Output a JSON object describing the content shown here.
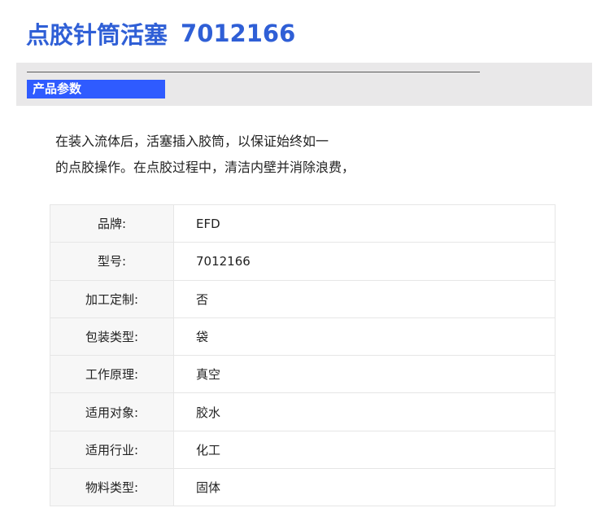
{
  "header": {
    "title": "点胶针筒活塞",
    "code": "7012166"
  },
  "section": {
    "label": "产品参数"
  },
  "description": {
    "line1": "在装入流体后，活塞插入胶筒，以保证始终如一",
    "line2": "的点胶操作。在点胶过程中，清洁内壁并消除浪费，"
  },
  "params": [
    {
      "key": "品牌:",
      "value": "EFD"
    },
    {
      "key": "型号:",
      "value": "7012166"
    },
    {
      "key": "加工定制:",
      "value": "否"
    },
    {
      "key": "包装类型:",
      "value": "袋"
    },
    {
      "key": "工作原理:",
      "value": "真空"
    },
    {
      "key": "适用对象:",
      "value": "胶水"
    },
    {
      "key": "适用行业:",
      "value": "化工"
    },
    {
      "key": "物料类型:",
      "value": "固体"
    }
  ],
  "colors": {
    "title": "#2f5fd6",
    "section_label_bg": "#2f5bff",
    "section_band_bg": "#e9e8e9"
  }
}
